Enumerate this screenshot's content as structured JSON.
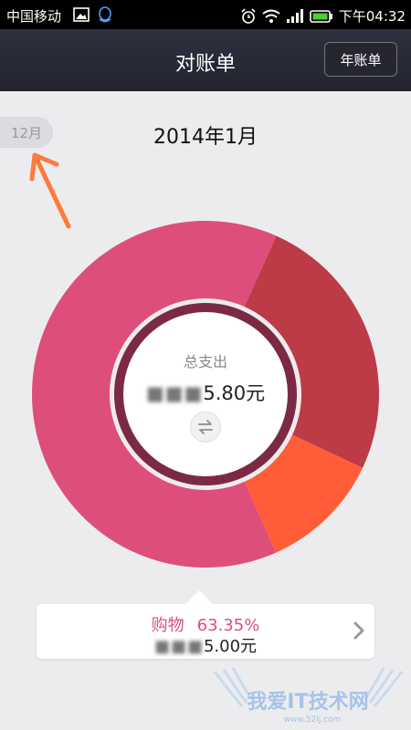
{
  "status_bar": {
    "carrier": "中国移动",
    "time": "下午04:32"
  },
  "header": {
    "title": "对账单",
    "year_button": "年账单"
  },
  "month_nav": {
    "prev_month": "12月",
    "current_month": "2014年1月"
  },
  "summary": {
    "label": "总支出",
    "amount_masked": "■■■",
    "amount_visible": "5.80元"
  },
  "detail": {
    "category": "购物",
    "percent": "63.35%",
    "amount_masked": "■■■",
    "amount_visible": "5.00元"
  },
  "chart_data": {
    "type": "pie",
    "slices": [
      {
        "label": "购物",
        "value": 63.35,
        "color": "#de4e7b"
      },
      {
        "label": "",
        "value": 25.3,
        "color": "#bd3a47"
      },
      {
        "label": "",
        "value": 11.35,
        "color": "#ff5c37"
      }
    ]
  },
  "colors": {
    "accent_pink": "#de4e7b",
    "accent_red": "#bd3a47",
    "accent_orange": "#ff5c37",
    "arrow_orange": "#ff7a3d",
    "header_bg": "#2a2b36"
  },
  "watermark": {
    "text": "我爱IT技术网",
    "url": "www.52ij.com"
  }
}
